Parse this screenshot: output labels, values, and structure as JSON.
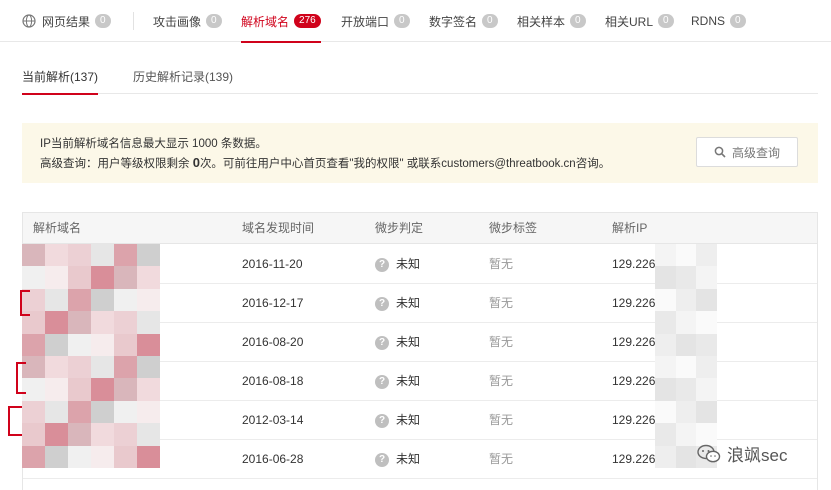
{
  "top_tabs": [
    {
      "label": "网页结果",
      "count": "0"
    },
    {
      "label": "攻击画像",
      "count": "0"
    },
    {
      "label": "解析域名",
      "count": "276"
    },
    {
      "label": "开放端口",
      "count": "0"
    },
    {
      "label": "数字签名",
      "count": "0"
    },
    {
      "label": "相关样本",
      "count": "0"
    },
    {
      "label": "相关URL",
      "count": "0"
    },
    {
      "label": "RDNS",
      "count": "0"
    }
  ],
  "sub_tabs": [
    {
      "label": "当前解析(137)"
    },
    {
      "label": "历史解析记录(139)"
    }
  ],
  "notice": {
    "line1": "IP当前解析域名信息最大显示 1000 条数据。",
    "line2_prefix": "高级查询：用户等级权限剩余 ",
    "line2_count": "0",
    "line2_suffix": "次。可前往用户中心首页查看\"我的权限\" 或联系customers@threatbook.cn咨询。",
    "button_label": "高级查询"
  },
  "table": {
    "headers": [
      "解析域名",
      "域名发现时间",
      "微步判定",
      "微步标签",
      "解析IP"
    ],
    "rows": [
      {
        "date": "2016-11-20",
        "judge": "未知",
        "tag": "暂无",
        "ip": "129.226"
      },
      {
        "date": "2016-12-17",
        "judge": "未知",
        "tag": "暂无",
        "ip": "129.226"
      },
      {
        "date": "2016-08-20",
        "judge": "未知",
        "tag": "暂无",
        "ip": "129.226"
      },
      {
        "date": "2016-08-18",
        "judge": "未知",
        "tag": "暂无",
        "ip": "129.226"
      },
      {
        "date": "2012-03-14",
        "judge": "未知",
        "tag": "暂无",
        "ip": "129.226"
      },
      {
        "date": "2016-06-28",
        "judge": "未知",
        "tag": "暂无",
        "ip": "129.226"
      }
    ]
  },
  "watermark": "浪飒sec",
  "colors": {
    "accent": "#d0021b",
    "notice_bg": "#fcf8e8",
    "badge_gray": "#c8c8c8"
  },
  "icons": [
    "globe-icon",
    "search-icon",
    "question-icon",
    "wechat-icon"
  ]
}
